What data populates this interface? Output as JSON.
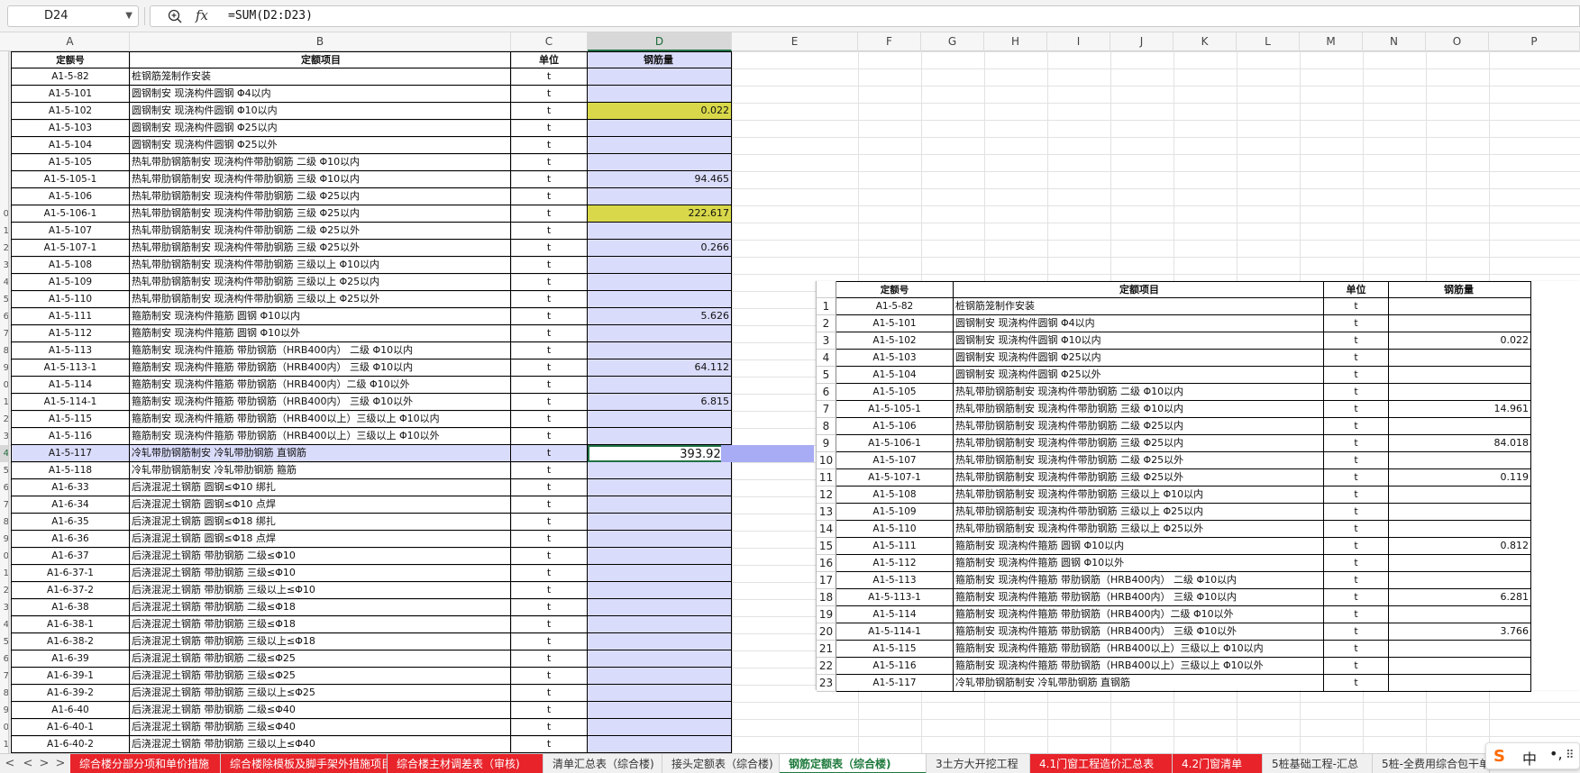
{
  "formula_bar": {
    "name_box": "D24",
    "formula": "=SUM(D2:D23)",
    "zoom_icon": "zoom-icon",
    "fx_label": "fx"
  },
  "columns": [
    "A",
    "B",
    "C",
    "D",
    "E",
    "F",
    "G",
    "H",
    "I",
    "J",
    "K",
    "L",
    "M",
    "N",
    "O",
    "P"
  ],
  "row_numbers": [
    "",
    "",
    "",
    "",
    "",
    "",
    "",
    "",
    "",
    "0",
    "1",
    "2",
    "3",
    "4",
    "5",
    "6",
    "7",
    "8",
    "9",
    "0",
    "1",
    "2",
    "3",
    "4",
    "5",
    "6",
    "7",
    "8",
    "9",
    "0",
    "1",
    "2",
    "3",
    "4",
    "5",
    "6",
    "7",
    "8",
    "9",
    "0",
    "1"
  ],
  "main_table": {
    "headers": [
      "定额号",
      "定额项目",
      "单位",
      "钢筋量"
    ],
    "rows": [
      [
        "A1-5-82",
        "桩钢筋笼制作安装",
        "t",
        ""
      ],
      [
        "A1-5-101",
        "圆钢制安 现浇构件圆钢 Φ4以内",
        "t",
        ""
      ],
      [
        "A1-5-102",
        "圆钢制安 现浇构件圆钢 Φ10以内",
        "t",
        "0.022"
      ],
      [
        "A1-5-103",
        "圆钢制安 现浇构件圆钢 Φ25以内",
        "t",
        ""
      ],
      [
        "A1-5-104",
        "圆钢制安 现浇构件圆钢 Φ25以外",
        "t",
        ""
      ],
      [
        "A1-5-105",
        "热轧带肋钢筋制安 现浇构件带肋钢筋 二级 Φ10以内",
        "t",
        ""
      ],
      [
        "A1-5-105-1",
        "热轧带肋钢筋制安 现浇构件带肋钢筋 三级 Φ10以内",
        "t",
        "94.465"
      ],
      [
        "A1-5-106",
        "热轧带肋钢筋制安 现浇构件带肋钢筋 二级 Φ25以内",
        "t",
        ""
      ],
      [
        "A1-5-106-1",
        "热轧带肋钢筋制安 现浇构件带肋钢筋 三级 Φ25以内",
        "t",
        "222.617"
      ],
      [
        "A1-5-107",
        "热轧带肋钢筋制安 现浇构件带肋钢筋 二级 Φ25以外",
        "t",
        ""
      ],
      [
        "A1-5-107-1",
        "热轧带肋钢筋制安 现浇构件带肋钢筋 三级 Φ25以外",
        "t",
        "0.266"
      ],
      [
        "A1-5-108",
        "热轧带肋钢筋制安 现浇构件带肋钢筋 三级以上 Φ10以内",
        "t",
        ""
      ],
      [
        "A1-5-109",
        "热轧带肋钢筋制安 现浇构件带肋钢筋 三级以上 Φ25以内",
        "t",
        ""
      ],
      [
        "A1-5-110",
        "热轧带肋钢筋制安 现浇构件带肋钢筋 三级以上 Φ25以外",
        "t",
        ""
      ],
      [
        "A1-5-111",
        "箍筋制安 现浇构件箍筋 圆钢 Φ10以内",
        "t",
        "5.626"
      ],
      [
        "A1-5-112",
        "箍筋制安 现浇构件箍筋 圆钢 Φ10以外",
        "t",
        ""
      ],
      [
        "A1-5-113",
        "箍筋制安 现浇构件箍筋 带肋钢筋（HRB400内） 二级 Φ10以内",
        "t",
        ""
      ],
      [
        "A1-5-113-1",
        "箍筋制安 现浇构件箍筋 带肋钢筋（HRB400内） 三级 Φ10以内",
        "t",
        "64.112"
      ],
      [
        "A1-5-114",
        "箍筋制安 现浇构件箍筋 带肋钢筋（HRB400内）二级 Φ10以外",
        "t",
        ""
      ],
      [
        "A1-5-114-1",
        "箍筋制安 现浇构件箍筋 带肋钢筋（HRB400内） 三级 Φ10以外",
        "t",
        "6.815"
      ],
      [
        "A1-5-115",
        "箍筋制安 现浇构件箍筋 带肋钢筋（HRB400以上）三级以上 Φ10以内",
        "t",
        ""
      ],
      [
        "A1-5-116",
        "箍筋制安 现浇构件箍筋 带肋钢筋（HRB400以上）三级以上 Φ10以外",
        "t",
        ""
      ],
      [
        "A1-5-117",
        "冷轧带肋钢筋制安 冷轧带肋钢筋 直钢筋",
        "t",
        "393.923"
      ],
      [
        "A1-5-118",
        "冷轧带肋钢筋制安 冷轧带肋钢筋 箍筋",
        "t",
        ""
      ],
      [
        "A1-6-33",
        "后浇混泥土钢筋 圆钢≤Φ10 绑扎",
        "t",
        ""
      ],
      [
        "A1-6-34",
        "后浇混泥土钢筋 圆钢≤Φ10 点焊",
        "t",
        ""
      ],
      [
        "A1-6-35",
        "后浇混泥土钢筋 圆钢≤Φ18 绑扎",
        "t",
        ""
      ],
      [
        "A1-6-36",
        "后浇混泥土钢筋 圆钢≤Φ18 点焊",
        "t",
        ""
      ],
      [
        "A1-6-37",
        "后浇混泥土钢筋 带肋钢筋  二级≤Φ10",
        "t",
        ""
      ],
      [
        "A1-6-37-1",
        "后浇混泥土钢筋 带肋钢筋  三级≤Φ10",
        "t",
        ""
      ],
      [
        "A1-6-37-2",
        "后浇混泥土钢筋 带肋钢筋  三级以上≤Φ10",
        "t",
        ""
      ],
      [
        "A1-6-38",
        "后浇混泥土钢筋 带肋钢筋  二级≤Φ18",
        "t",
        ""
      ],
      [
        "A1-6-38-1",
        "后浇混泥土钢筋 带肋钢筋  三级≤Φ18",
        "t",
        ""
      ],
      [
        "A1-6-38-2",
        "后浇混泥土钢筋 带肋钢筋  三级以上≤Φ18",
        "t",
        ""
      ],
      [
        "A1-6-39",
        "后浇混泥土钢筋 带肋钢筋  二级≤Φ25",
        "t",
        ""
      ],
      [
        "A1-6-39-1",
        "后浇混泥土钢筋 带肋钢筋  三级≤Φ25",
        "t",
        ""
      ],
      [
        "A1-6-39-2",
        "后浇混泥土钢筋 带肋钢筋  三级以上≤Φ25",
        "t",
        ""
      ],
      [
        "A1-6-40",
        "后浇混泥土钢筋 带肋钢筋  二级≤Φ40",
        "t",
        ""
      ],
      [
        "A1-6-40-1",
        "后浇混泥土钢筋 带肋钢筋  三级≤Φ40",
        "t",
        ""
      ],
      [
        "A1-6-40-2",
        "后浇混泥土钢筋 带肋钢筋  三级以上≤Φ40",
        "t",
        ""
      ]
    ],
    "highlighted": [
      "A1-5-102",
      "A1-5-106-1"
    ],
    "selected_row": "A1-5-117"
  },
  "picture_table": {
    "headers": [
      "定额号",
      "定额项目",
      "单位",
      "钢筋量"
    ],
    "rows": [
      [
        "1",
        "A1-5-82",
        "桩钢筋笼制作安装",
        "t",
        ""
      ],
      [
        "2",
        "A1-5-101",
        "圆钢制安 现浇构件圆钢 Φ4以内",
        "t",
        ""
      ],
      [
        "3",
        "A1-5-102",
        "圆钢制安 现浇构件圆钢 Φ10以内",
        "t",
        "0.022"
      ],
      [
        "4",
        "A1-5-103",
        "圆钢制安 现浇构件圆钢 Φ25以内",
        "t",
        ""
      ],
      [
        "5",
        "A1-5-104",
        "圆钢制安 现浇构件圆钢 Φ25以外",
        "t",
        ""
      ],
      [
        "6",
        "A1-5-105",
        "热轧带肋钢筋制安 现浇构件带肋钢筋 二级 Φ10以内",
        "t",
        ""
      ],
      [
        "7",
        "A1-5-105-1",
        "热轧带肋钢筋制安 现浇构件带肋钢筋 三级 Φ10以内",
        "t",
        "14.961"
      ],
      [
        "8",
        "A1-5-106",
        "热轧带肋钢筋制安 现浇构件带肋钢筋 二级 Φ25以内",
        "t",
        ""
      ],
      [
        "9",
        "A1-5-106-1",
        "热轧带肋钢筋制安 现浇构件带肋钢筋 三级 Φ25以内",
        "t",
        "84.018"
      ],
      [
        "10",
        "A1-5-107",
        "热轧带肋钢筋制安 现浇构件带肋钢筋 二级 Φ25以外",
        "t",
        ""
      ],
      [
        "11",
        "A1-5-107-1",
        "热轧带肋钢筋制安 现浇构件带肋钢筋 三级 Φ25以外",
        "t",
        "0.119"
      ],
      [
        "12",
        "A1-5-108",
        "热轧带肋钢筋制安 现浇构件带肋钢筋 三级以上 Φ10以内",
        "t",
        ""
      ],
      [
        "13",
        "A1-5-109",
        "热轧带肋钢筋制安 现浇构件带肋钢筋 三级以上 Φ25以内",
        "t",
        ""
      ],
      [
        "14",
        "A1-5-110",
        "热轧带肋钢筋制安 现浇构件带肋钢筋 三级以上 Φ25以外",
        "t",
        ""
      ],
      [
        "15",
        "A1-5-111",
        "箍筋制安 现浇构件箍筋 圆钢 Φ10以内",
        "t",
        "0.812"
      ],
      [
        "16",
        "A1-5-112",
        "箍筋制安 现浇构件箍筋 圆钢 Φ10以外",
        "t",
        ""
      ],
      [
        "17",
        "A1-5-113",
        "箍筋制安 现浇构件箍筋 带肋钢筋（HRB400内） 二级 Φ10以内",
        "t",
        ""
      ],
      [
        "18",
        "A1-5-113-1",
        "箍筋制安 现浇构件箍筋 带肋钢筋（HRB400内） 三级 Φ10以内",
        "t",
        "6.281"
      ],
      [
        "19",
        "A1-5-114",
        "箍筋制安 现浇构件箍筋 带肋钢筋（HRB400内）二级 Φ10以外",
        "t",
        ""
      ],
      [
        "20",
        "A1-5-114-1",
        "箍筋制安 现浇构件箍筋 带肋钢筋（HRB400内） 三级 Φ10以外",
        "t",
        "3.766"
      ],
      [
        "21",
        "A1-5-115",
        "箍筋制安 现浇构件箍筋 带肋钢筋（HRB400以上）三级以上 Φ10以内",
        "t",
        ""
      ],
      [
        "22",
        "A1-5-116",
        "箍筋制安 现浇构件箍筋 带肋钢筋（HRB400以上）三级以上 Φ10以外",
        "t",
        ""
      ],
      [
        "23",
        "A1-5-117",
        "冷轧带肋钢筋制安 冷轧带肋钢筋 直钢筋",
        "t",
        ""
      ]
    ]
  },
  "sheet_tabs": [
    {
      "label": "综合楼分部分项和单价措施",
      "style": "red"
    },
    {
      "label": "综合楼除模板及脚手架外措施项目",
      "style": "red"
    },
    {
      "label": "综合楼主材调差表（审核)",
      "style": "red"
    },
    {
      "label": "清单汇总表（综合楼)",
      "style": "normal"
    },
    {
      "label": "接头定额表（综合楼)",
      "style": "normal"
    },
    {
      "label": "钢筋定额表（综合楼)",
      "style": "active"
    },
    {
      "label": "3土方大开挖工程",
      "style": "normal"
    },
    {
      "label": "4.1门窗工程造价汇总表",
      "style": "red"
    },
    {
      "label": "4.2门窗清单",
      "style": "red"
    },
    {
      "label": "5桩基础工程-汇总",
      "style": "normal"
    },
    {
      "label": "5桩-全费用综合包干单价",
      "style": "normal"
    }
  ],
  "tab_nav": [
    "<",
    "<",
    ">",
    ">"
  ],
  "ime": {
    "logo": "S",
    "mode": "中",
    "punct": "•,",
    "grid": "⠿"
  },
  "colors": {
    "accent": "#217346",
    "red_tab": "#e8232a",
    "d_fill": "#dadcfb",
    "yellow_fill": "#d8d84a"
  }
}
